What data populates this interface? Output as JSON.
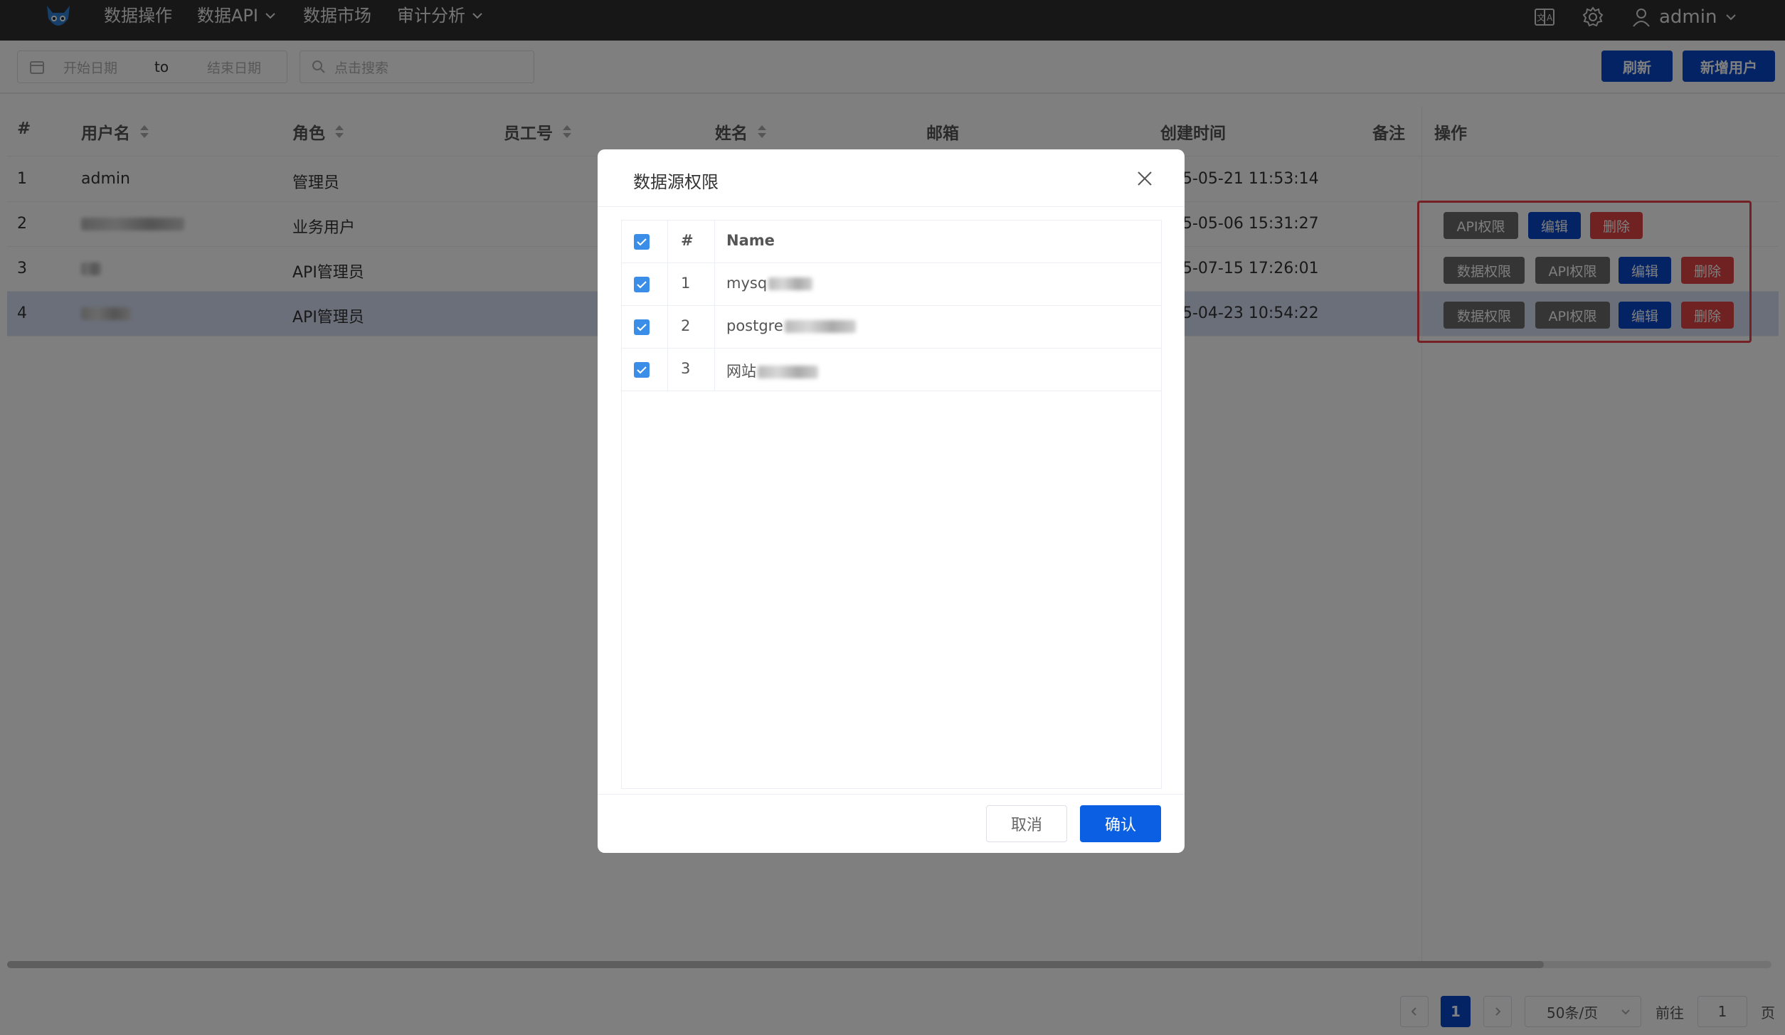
{
  "nav": {
    "items": [
      {
        "label": "数据操作",
        "has_dropdown": false
      },
      {
        "label": "数据API",
        "has_dropdown": true
      },
      {
        "label": "数据市场",
        "has_dropdown": false
      },
      {
        "label": "审计分析",
        "has_dropdown": true
      }
    ],
    "icons": [
      "translate-icon",
      "gear-icon",
      "user-icon"
    ],
    "user": "admin"
  },
  "toolbar": {
    "start_placeholder": "开始日期",
    "range_separator": "to",
    "end_placeholder": "结束日期",
    "search_placeholder": "点击搜索",
    "refresh_label": "刷新",
    "add_user_label": "新增用户"
  },
  "table": {
    "headers": {
      "index": "#",
      "username": "用户名",
      "role": "角色",
      "employee_no": "员工号",
      "name": "姓名",
      "email": "邮箱",
      "created": "创建时间",
      "remark": "备注",
      "actions": "操作"
    },
    "rows": [
      {
        "index": "1",
        "username": "admin",
        "role": "管理员",
        "created": "5-05-21 11:53:14"
      },
      {
        "index": "2",
        "username": "",
        "role": "业务用户",
        "created": "5-05-06 15:31:27"
      },
      {
        "index": "3",
        "username": "",
        "role": "API管理员",
        "created": "5-07-15 17:26:01"
      },
      {
        "index": "4",
        "username": "",
        "role": "API管理员",
        "created": "5-04-23 10:54:22"
      }
    ],
    "actions": {
      "data_perm": "数据权限",
      "api_perm": "API权限",
      "edit": "编辑",
      "delete": "删除"
    }
  },
  "pagination": {
    "current_page": "1",
    "page_size": "50条/页",
    "goto_label": "前往",
    "goto_value": "1",
    "page_suffix": "页"
  },
  "modal": {
    "title": "数据源权限",
    "columns": {
      "index": "#",
      "name": "Name"
    },
    "rows": [
      {
        "index": "1",
        "name": "mysq",
        "checked": true
      },
      {
        "index": "2",
        "name": "postgre",
        "checked": true
      },
      {
        "index": "3",
        "name": "网站",
        "checked": true
      }
    ],
    "cancel_label": "取消",
    "confirm_label": "确认"
  },
  "colors": {
    "primary": "#0747c9",
    "danger": "#e04545",
    "navbar": "#2f2f2f",
    "highlight_row": "#d6dff5",
    "checkbox": "#3b8ee8"
  }
}
